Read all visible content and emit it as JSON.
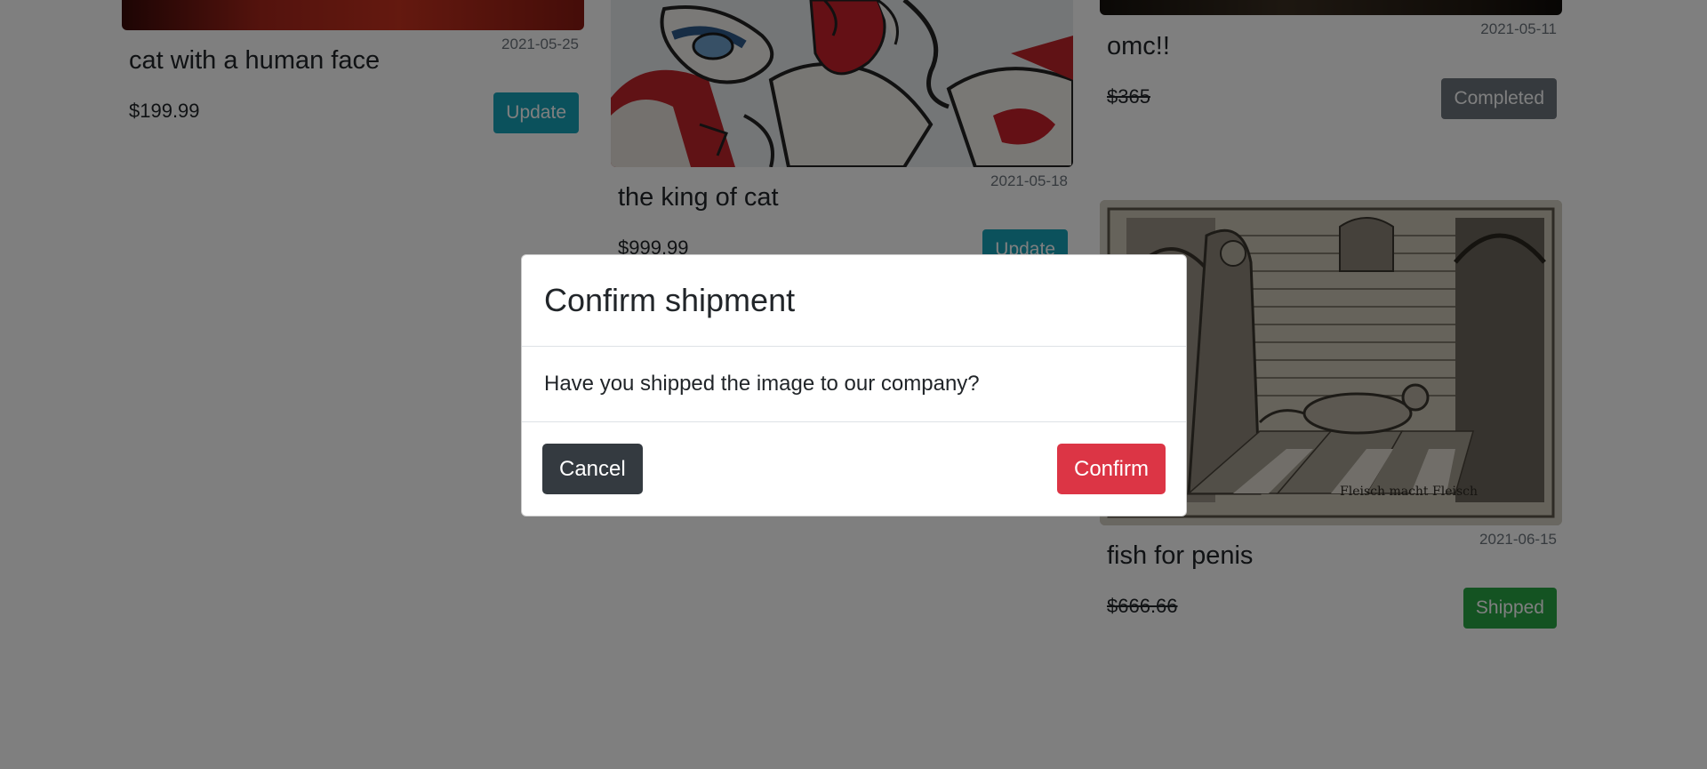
{
  "cards": [
    {
      "title": "cat with a human face",
      "date": "2021-05-25",
      "price": "$199.99",
      "status": "Update"
    },
    {
      "title": "the king of cat",
      "date": "2021-05-18",
      "price": "$999.99",
      "status": "Update"
    },
    {
      "title": "omc!!",
      "date": "2021-05-11",
      "price": "$365",
      "status": "Completed"
    },
    {
      "title": "fish for penis",
      "date": "2021-06-15",
      "price": "$666.66",
      "status": "Shipped",
      "image_caption": "Fleisch macht Fleisch"
    }
  ],
  "colors": {
    "update": "#17a2b8",
    "completed": "#6c757d",
    "shipped": "#28a745",
    "cancel": "#343a40",
    "confirm": "#dc3545"
  },
  "modal": {
    "title": "Confirm shipment",
    "message": "Have you shipped the image to our company?",
    "cancel_label": "Cancel",
    "confirm_label": "Confirm"
  }
}
